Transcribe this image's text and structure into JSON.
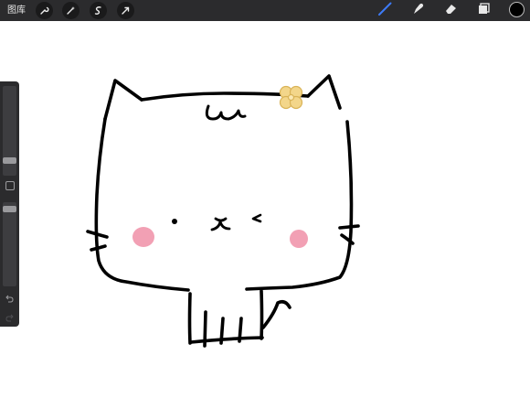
{
  "toolbar": {
    "gallery_label": "图库",
    "left_tools": [
      "wrench-icon",
      "magic-wand-icon",
      "selection-icon",
      "transform-arrow-icon"
    ],
    "right_tools": [
      "brush-icon",
      "smudge-icon",
      "eraser-icon",
      "layers-icon"
    ],
    "active_tool": "brush-icon",
    "active_tool_color": "#3d7bf7",
    "current_color": "#000000"
  },
  "sidebar": {
    "controls": [
      "brush-size-slider",
      "modify-button",
      "opacity-slider",
      "undo-button",
      "redo-button"
    ]
  },
  "canvas": {
    "drawing": "cat-drawing",
    "background": "#ffffff",
    "cheek_color": "#f2a0b4",
    "bow_color": "#f3d68a"
  }
}
